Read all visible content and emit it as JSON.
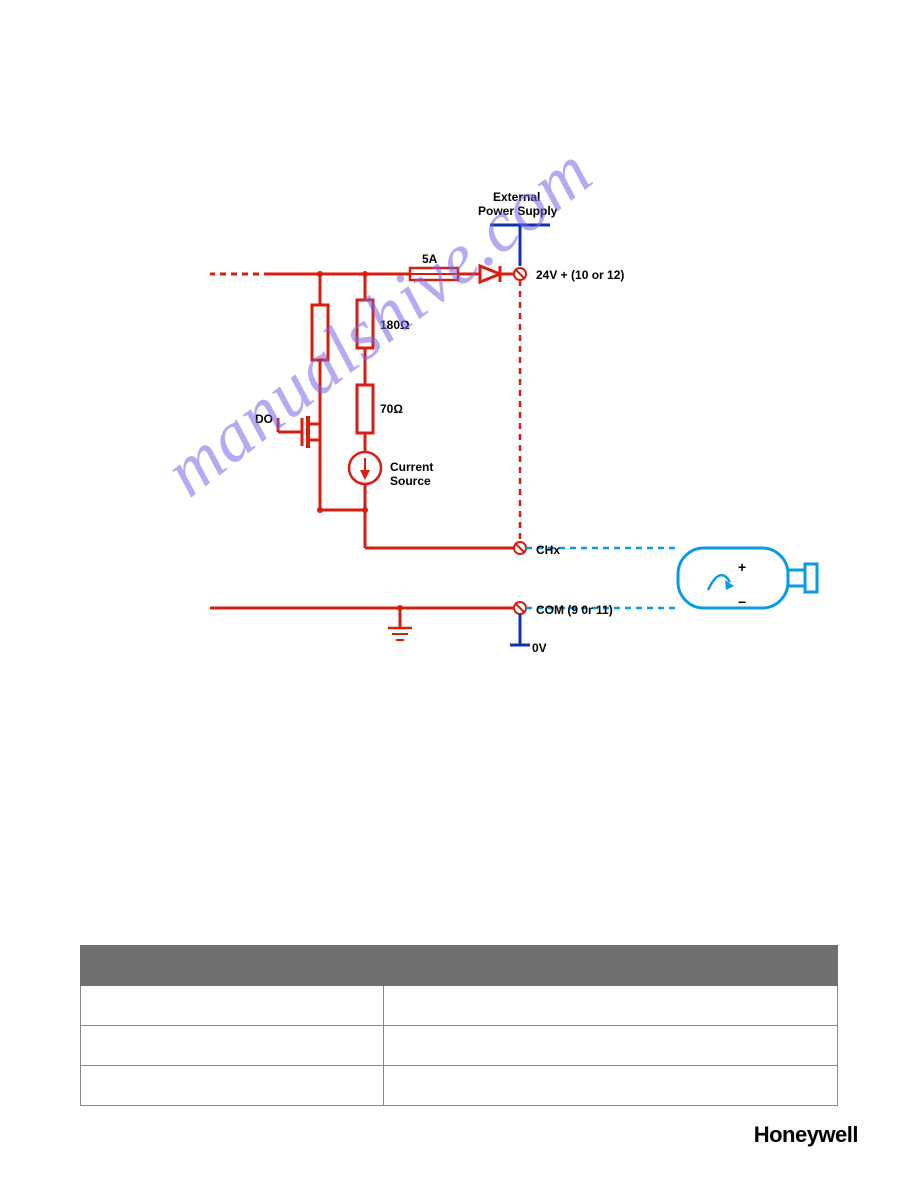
{
  "diagram": {
    "labels": {
      "power_supply_l1": "External",
      "power_supply_l2": "Power Supply",
      "fuse": "5A",
      "r1": "180Ω",
      "r2": "70Ω",
      "do": "DO",
      "current_source_l1": "Current",
      "current_source_l2": "Source",
      "v24": "24V + (10 or 12)",
      "chx": "CHx",
      "com": "COM (9 0r 11)",
      "zero_v": "0V",
      "load_plus": "+",
      "load_minus": "−"
    }
  },
  "watermark": "manualshive.com",
  "table": {
    "headers": [
      "",
      ""
    ],
    "rows": [
      [
        "",
        ""
      ],
      [
        "",
        ""
      ],
      [
        "",
        ""
      ]
    ]
  },
  "footer": {
    "brand": "Honeywell"
  }
}
